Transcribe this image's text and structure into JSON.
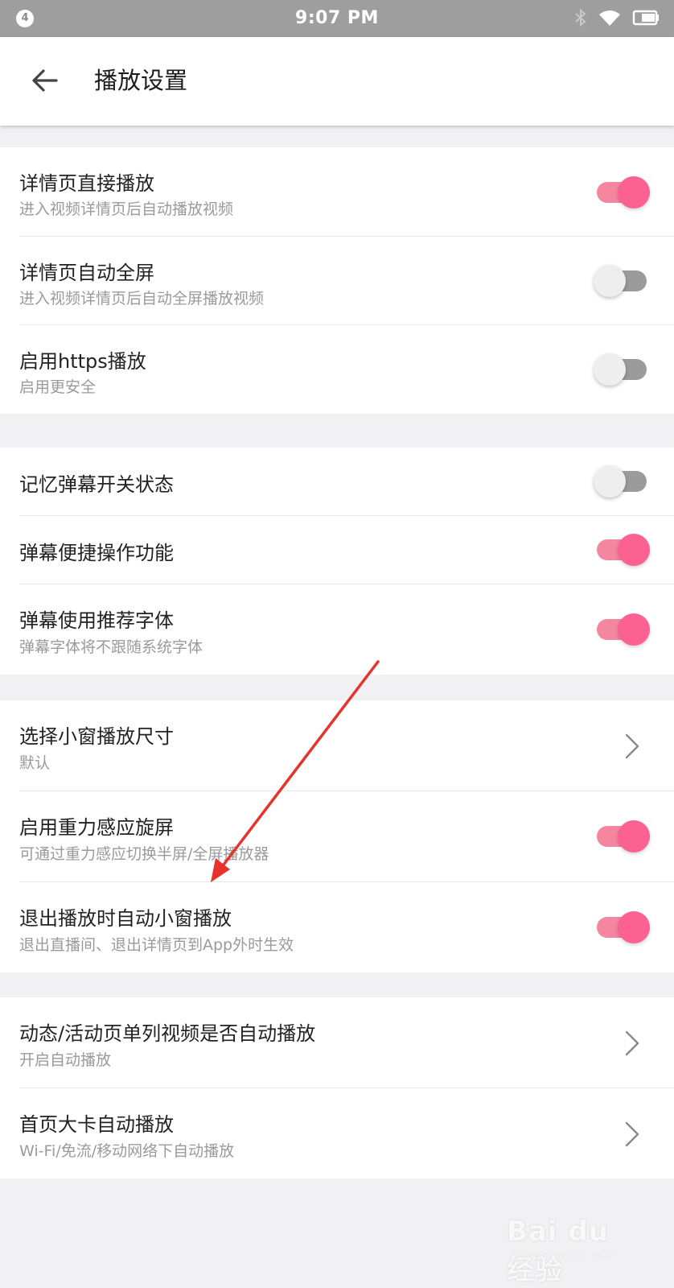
{
  "status_bar": {
    "notification_count": "4",
    "time": "9:07 PM",
    "icons": [
      "bluetooth-icon",
      "wifi-icon",
      "battery-icon"
    ]
  },
  "header": {
    "back_icon": "arrow-left-icon",
    "title": "播放设置"
  },
  "sections": [
    {
      "items": [
        {
          "title": "详情页直接播放",
          "subtitle": "进入视频详情页后自动播放视频",
          "control": "toggle",
          "on": true
        },
        {
          "title": "详情页自动全屏",
          "subtitle": "进入视频详情页后自动全屏播放视频",
          "control": "toggle",
          "on": false
        },
        {
          "title": "启用https播放",
          "subtitle": "启用更安全",
          "control": "toggle",
          "on": false
        }
      ]
    },
    {
      "items": [
        {
          "title": "记忆弹幕开关状态",
          "control": "toggle",
          "on": false
        },
        {
          "title": "弹幕便捷操作功能",
          "control": "toggle",
          "on": true
        },
        {
          "title": "弹幕使用推荐字体",
          "subtitle": "弹幕字体将不跟随系统字体",
          "control": "toggle",
          "on": true
        }
      ]
    },
    {
      "items": [
        {
          "title": "选择小窗播放尺寸",
          "subtitle": "默认",
          "control": "chevron"
        },
        {
          "title": "启用重力感应旋屏",
          "subtitle": "可通过重力感应切换半屏/全屏播放器",
          "control": "toggle",
          "on": true
        },
        {
          "title": "退出播放时自动小窗播放",
          "subtitle": "退出直播间、退出详情页到App外时生效",
          "control": "toggle",
          "on": true
        }
      ]
    },
    {
      "items": [
        {
          "title": "动态/活动页单列视频是否自动播放",
          "subtitle": "开启自动播放",
          "control": "chevron"
        },
        {
          "title": "首页大卡自动播放",
          "subtitle": "Wi-Fi/免流/移动网络下自动播放",
          "control": "chevron"
        }
      ]
    }
  ],
  "watermark": {
    "logo": "Bai du 经验",
    "url": "jingyan.baidu.com"
  },
  "colors": {
    "accent_pink": "#fb6291",
    "toggle_track_on": "#f4869f",
    "toggle_track_off": "#9b9b9b",
    "annotation_arrow": "#e8322c",
    "page_background": "#f1f1f3",
    "status_bar": "#9e9e9e"
  }
}
